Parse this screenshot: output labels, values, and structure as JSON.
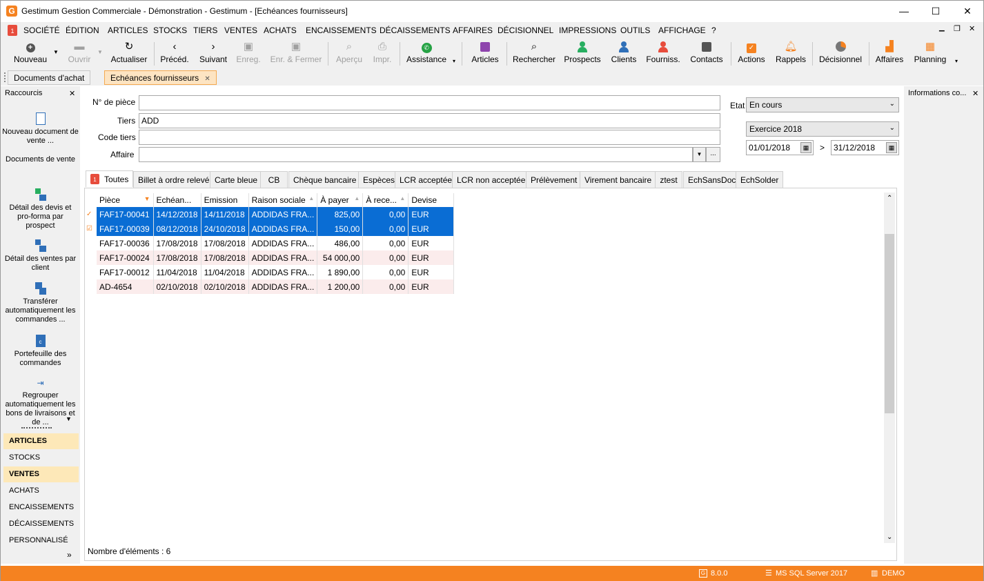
{
  "window": {
    "title": "Gestimum Gestion Commerciale - Démonstration - Gestimum - [Echéances fournisseurs]",
    "minimize": "—",
    "maximize": "☐",
    "close": "✕"
  },
  "menu": [
    "SOCIÉTÉ",
    "ÉDITION",
    "ARTICLES",
    "STOCKS",
    "TIERS",
    "VENTES",
    "ACHATS",
    "ENCAISSEMENTS",
    "DÉCAISSEMENTS",
    "AFFAIRES",
    "DÉCISIONNEL",
    "IMPRESSIONS",
    "OUTILS",
    "AFFICHAGE",
    "?"
  ],
  "toolbar": {
    "nouveau": "Nouveau",
    "ouvrir": "Ouvrir",
    "actualiser": "Actualiser",
    "preced": "Précéd.",
    "suivant": "Suivant",
    "enreg": "Enreg.",
    "enr_fermer": "Enr. & Fermer",
    "apercu": "Aperçu",
    "impr": "Impr.",
    "assistance": "Assistance",
    "articles": "Articles",
    "rechercher": "Rechercher",
    "prospects": "Prospects",
    "clients": "Clients",
    "fourniss": "Fourniss.",
    "contacts": "Contacts",
    "actions": "Actions",
    "rappels": "Rappels",
    "decisionnel": "Décisionnel",
    "affaires": "Affaires",
    "planning": "Planning"
  },
  "doc_tabs": {
    "tab1": "Documents d'achat",
    "tab2": "Echéances fournisseurs",
    "close": "✕"
  },
  "left_panel": {
    "title": "Raccourcis",
    "close": "✕",
    "shortcuts": [
      "Nouveau document de vente ...",
      "Documents de vente",
      "Détail des devis et pro-forma par prospect",
      "Détail des ventes par client",
      "Transférer automatiquement les commandes ...",
      "Portefeuille des commandes",
      "Regrouper automatiquement les bons de livraisons et de ..."
    ],
    "sections": [
      "ARTICLES",
      "STOCKS",
      "VENTES",
      "ACHATS",
      "ENCAISSEMENTS",
      "DÉCAISSEMENTS",
      "PERSONNALISÉ"
    ],
    "more": "»"
  },
  "filters": {
    "piece_label": "N° de pièce",
    "piece_value": "",
    "tiers_label": "Tiers",
    "tiers_value": "ADD",
    "code_tiers_label": "Code tiers",
    "code_tiers_value": "",
    "affaire_label": "Affaire",
    "affaire_value": "",
    "etat_label": "Etat",
    "etat_value": "En cours",
    "exercice_value": "Exercice 2018",
    "date_from": "01/01/2018",
    "date_sep": ">",
    "date_to": "31/12/2018",
    "ellipsis": "..."
  },
  "payment_tabs": [
    "Toutes",
    "Billet à ordre relevé",
    "Carte bleue",
    "CB",
    "Chèque bancaire",
    "Espèces",
    "LCR acceptée",
    "LCR non acceptée",
    "Prélèvement",
    "Virement bancaire",
    "ztest",
    "EchSansDoc",
    "EchSolder"
  ],
  "grid": {
    "columns": [
      "Pièce",
      "Echéan...",
      "Emission",
      "Raison sociale",
      "À payer",
      "À rece...",
      "Devise"
    ],
    "rows": [
      {
        "piece": "FAF17-00041",
        "echeance": "14/12/2018",
        "emission": "14/11/2018",
        "raison": "ADDIDAS FRA...",
        "apayer": "825,00",
        "arecevoir": "0,00",
        "devise": "EUR",
        "selected": true
      },
      {
        "piece": "FAF17-00039",
        "echeance": "08/12/2018",
        "emission": "24/10/2018",
        "raison": "ADDIDAS FRA...",
        "apayer": "150,00",
        "arecevoir": "0,00",
        "devise": "EUR",
        "selected": true
      },
      {
        "piece": "FAF17-00036",
        "echeance": "17/08/2018",
        "emission": "17/08/2018",
        "raison": "ADDIDAS FRA...",
        "apayer": "486,00",
        "arecevoir": "0,00",
        "devise": "EUR",
        "selected": false
      },
      {
        "piece": "FAF17-00024",
        "echeance": "17/08/2018",
        "emission": "17/08/2018",
        "raison": "ADDIDAS FRA...",
        "apayer": "54 000,00",
        "arecevoir": "0,00",
        "devise": "EUR",
        "selected": false
      },
      {
        "piece": "FAF17-00012",
        "echeance": "11/04/2018",
        "emission": "11/04/2018",
        "raison": "ADDIDAS FRA...",
        "apayer": "1 890,00",
        "arecevoir": "0,00",
        "devise": "EUR",
        "selected": false
      },
      {
        "piece": "AD-4654",
        "echeance": "02/10/2018",
        "emission": "02/10/2018",
        "raison": "ADDIDAS FRA...",
        "apayer": "1 200,00",
        "arecevoir": "0,00",
        "devise": "EUR",
        "selected": false
      }
    ],
    "count_label": "Nombre d'éléments : 6"
  },
  "right_panel": {
    "title": "Informations co...",
    "close": "✕"
  },
  "status": {
    "version": "8.0.0",
    "server": "MS SQL Server 2017",
    "db": "DEMO"
  },
  "colors": {
    "accent": "#f58220",
    "selection": "#0a6dd4",
    "highlight_section": "#fde8b8"
  }
}
